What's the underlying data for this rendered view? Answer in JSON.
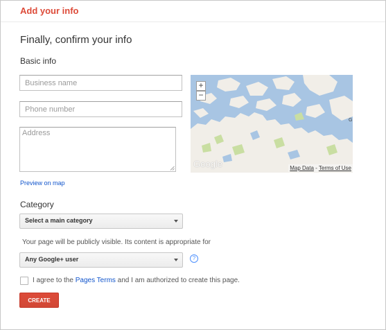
{
  "header": {
    "title": "Add your info"
  },
  "form": {
    "heading": "Finally, confirm your info",
    "basic_info_label": "Basic info",
    "business_name": {
      "placeholder": "Business name",
      "value": ""
    },
    "phone_number": {
      "placeholder": "Phone number",
      "value": ""
    },
    "address": {
      "placeholder": "Address",
      "value": ""
    },
    "preview_link": "Preview on map",
    "category_label": "Category",
    "category_select": {
      "selected": "Select a main category"
    },
    "visibility_text": "Your page will be publicly visible. Its content is appropriate for",
    "audience_select": {
      "selected": "Any Google+ user"
    },
    "help_icon_glyph": "?",
    "agree": {
      "prefix": "I agree to the ",
      "link": "Pages Terms",
      "suffix": " and I am authorized to create this page."
    },
    "create_button": "CREATE"
  },
  "map": {
    "zoom_in": "+",
    "zoom_out": "−",
    "logo_text": "Google",
    "map_data_link": "Map Data",
    "separator": " - ",
    "terms_link": "Terms of Use",
    "edge_label": "G",
    "water_color": "#a8c5e3",
    "land_color": "#f1eee8",
    "park_color": "#c9dea2"
  },
  "colors": {
    "brand_red": "#dd4b39",
    "link_blue": "#1155cc"
  }
}
